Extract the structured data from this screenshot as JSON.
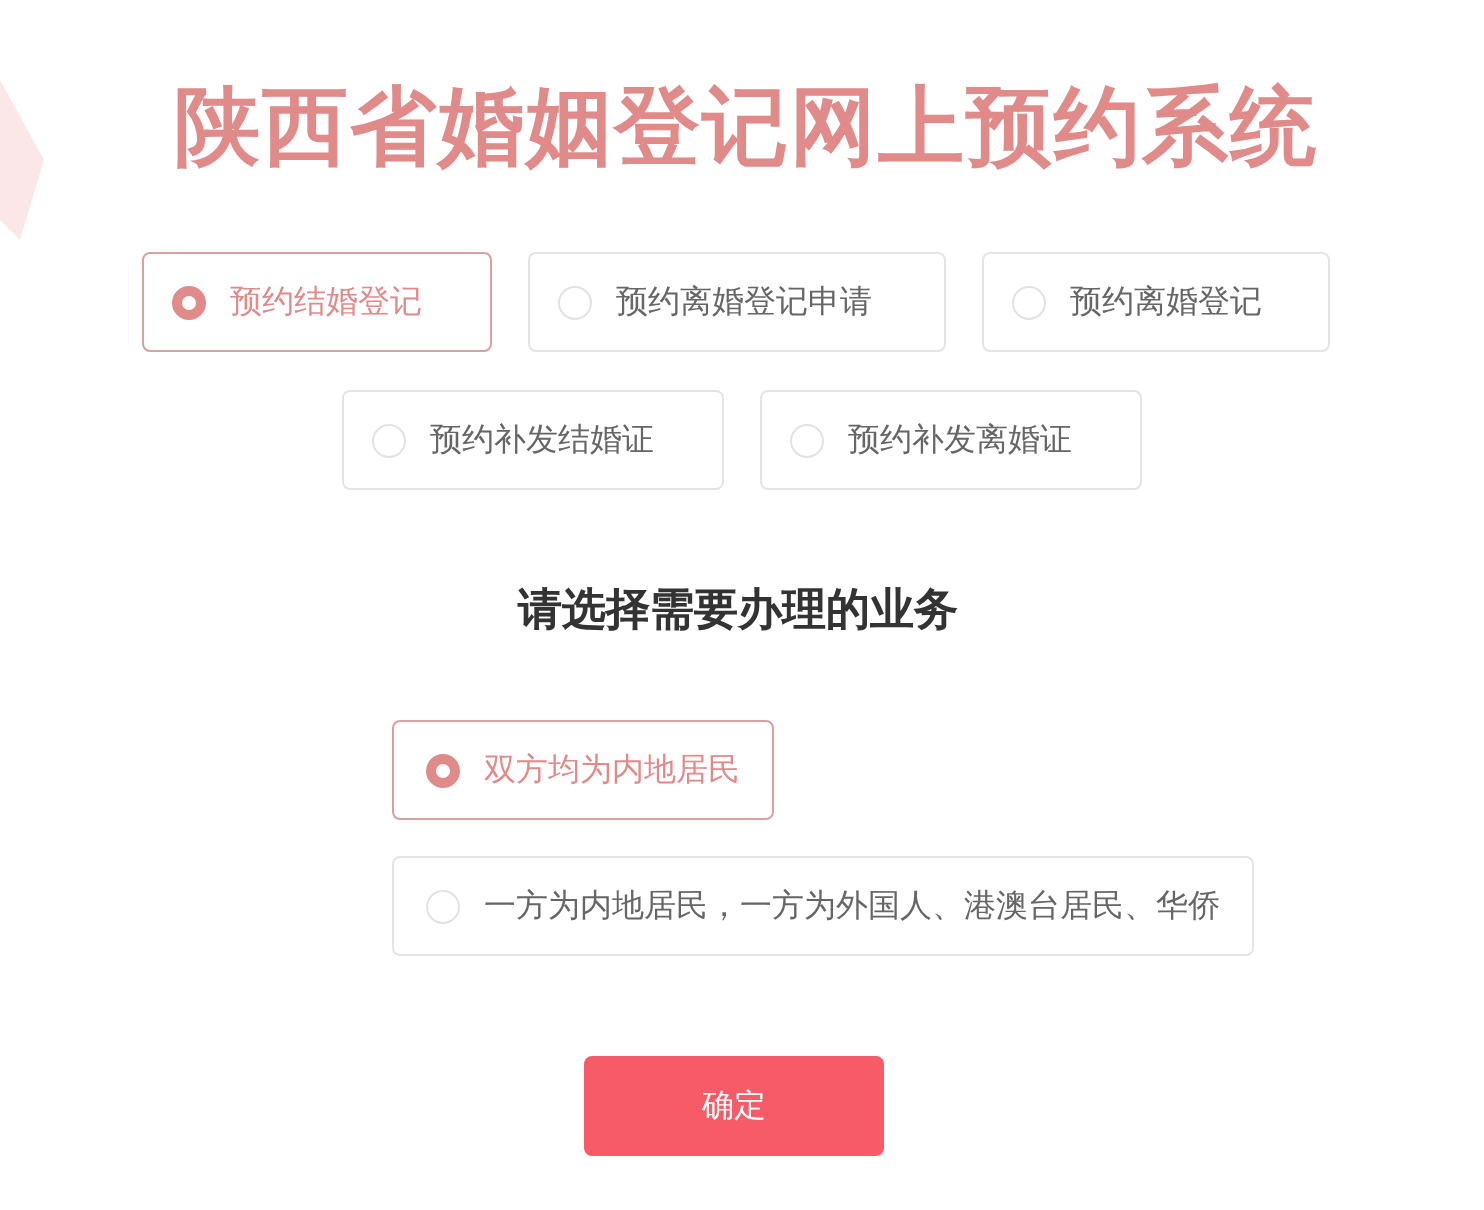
{
  "title": "陕西省婚姻登记网上预约系统",
  "services": [
    {
      "label": "预约结婚登记",
      "selected": true
    },
    {
      "label": "预约离婚登记申请",
      "selected": false
    },
    {
      "label": "预约离婚登记",
      "selected": false
    },
    {
      "label": "预约补发结婚证",
      "selected": false
    },
    {
      "label": "预约补发离婚证",
      "selected": false
    }
  ],
  "prompt": "请选择需要办理的业务",
  "residency": [
    {
      "label": "双方均为内地居民",
      "selected": true
    },
    {
      "label": "一方为内地居民，一方为外国人、港澳台居民、华侨",
      "selected": false
    }
  ],
  "confirm_button": "确定"
}
